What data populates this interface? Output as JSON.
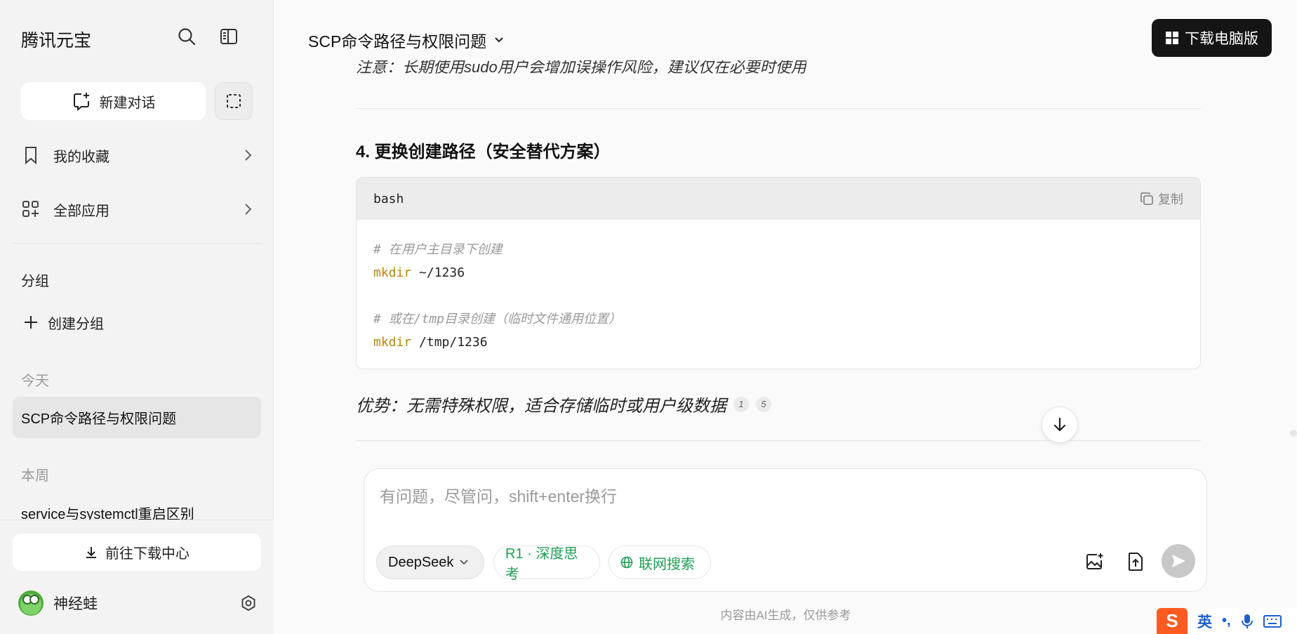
{
  "sidebar": {
    "brand": "腾讯元宝",
    "new_chat_label": "新建对话",
    "nav": [
      {
        "label": "我的收藏"
      },
      {
        "label": "全部应用"
      }
    ],
    "groups_title": "分组",
    "create_group_label": "创建分组",
    "today_label": "今天",
    "active_conversation": "SCP命令路径与权限问题",
    "week_label": "本周",
    "week_conversation": "service与systemctl重启区别",
    "download_center_label": "前往下载中心",
    "user_name": "神经蛙"
  },
  "header": {
    "conversation_title": "SCP命令路径与权限问题",
    "download_pc_label": "下载电脑版"
  },
  "content": {
    "note_partial": "注意：长期使用sudo用户会增加误操作风险，建议仅在必要时使用",
    "heading": "4. 更换创建路径（安全替代方案）",
    "code": {
      "language": "bash",
      "copy_label": "复制",
      "lines": [
        {
          "comment": "# 在用户主目录下创建"
        },
        {
          "keyword": "mkdir",
          "text": " ~/1236"
        },
        {
          "blank": true
        },
        {
          "comment": "# 或在/tmp目录创建（临时文件通用位置）"
        },
        {
          "keyword": "mkdir",
          "text": " /tmp/1236"
        }
      ]
    },
    "advantage": "优势：无需特殊权限，适合存储临时或用户级数据",
    "citations": [
      "1",
      "5"
    ]
  },
  "input": {
    "placeholder": "有问题，尽管问，shift+enter换行",
    "model_label": "DeepSeek",
    "r1_label": "R1 · 深度思考",
    "web_label": "联网搜索"
  },
  "disclaimer": "内容由AI生成，仅供参考",
  "ime": {
    "logo": "S",
    "lang": "英",
    "punct": "•,"
  },
  "colors": {
    "accent_green": "#1f9d55",
    "code_keyword": "#b8860b",
    "dark_button": "#151515"
  }
}
